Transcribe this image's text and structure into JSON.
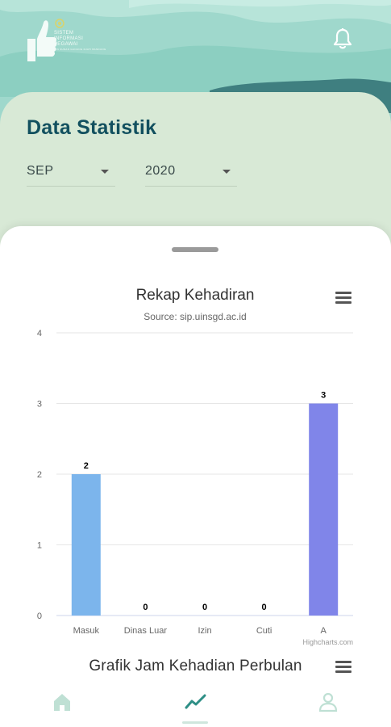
{
  "header": {
    "logo_text": [
      "SISTEM",
      "INFORMASI",
      "PEGAWAI"
    ],
    "logo_subtext": "UIN SUNAN GUNUNG DJATI BANDUNG",
    "bell_icon": "bell-icon"
  },
  "stats": {
    "title": "Data Statistik",
    "month": "SEP",
    "year": "2020"
  },
  "chart_data": {
    "type": "bar",
    "title": "Rekap Kehadiran",
    "subtitle": "Source: sip.uinsgd.ac.id",
    "categories": [
      "Masuk",
      "Dinas Luar",
      "Izin",
      "Cuti",
      "A"
    ],
    "values": [
      2,
      0,
      0,
      0,
      3
    ],
    "data_labels": [
      "2",
      "0",
      "0",
      "0",
      "3"
    ],
    "colors": [
      "#7cb5ec",
      "#7cb5ec",
      "#7cb5ec",
      "#7cb5ec",
      "#8085e9"
    ],
    "ylim": [
      0,
      4
    ],
    "yticks": [
      "0",
      "1",
      "2",
      "3",
      "4"
    ],
    "grid": true,
    "credits": "Highcharts.com"
  },
  "chart2": {
    "title": "Grafik Jam Kehadian Perbulan"
  },
  "nav": {
    "items": [
      "home-icon",
      "chart-line-icon",
      "user-icon"
    ],
    "active_color": "#2e8f86",
    "inactive_color": "#bfe0d4"
  }
}
